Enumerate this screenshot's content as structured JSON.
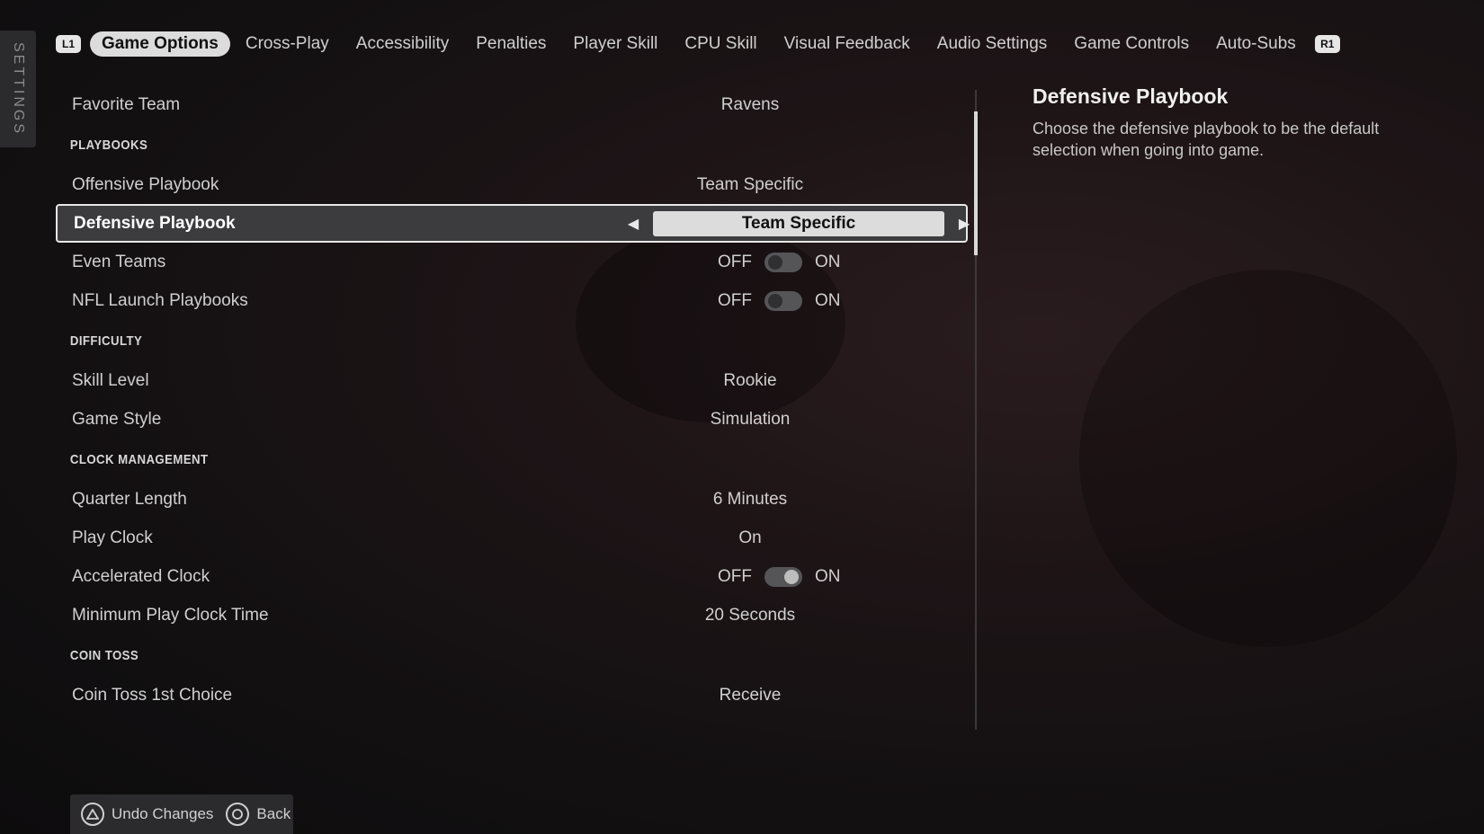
{
  "side_tab": {
    "label": "SETTINGS"
  },
  "nav": {
    "left_badge": "L1",
    "right_badge": "R1",
    "tabs": [
      "Game Options",
      "Cross-Play",
      "Accessibility",
      "Penalties",
      "Player Skill",
      "CPU Skill",
      "Visual Feedback",
      "Audio Settings",
      "Game Controls",
      "Auto-Subs"
    ],
    "active_tab": "Game Options"
  },
  "settings": {
    "favorite_team": {
      "label": "Favorite Team",
      "value": "Ravens"
    },
    "playbooks_header": "PLAYBOOKS",
    "offensive_playbook": {
      "label": "Offensive Playbook",
      "value": "Team Specific"
    },
    "defensive_playbook": {
      "label": "Defensive Playbook",
      "value": "Team Specific"
    },
    "even_teams": {
      "label": "Even Teams",
      "off": "OFF",
      "on": "ON",
      "state": "off"
    },
    "nfl_launch_playbooks": {
      "label": "NFL Launch Playbooks",
      "off": "OFF",
      "on": "ON",
      "state": "off"
    },
    "difficulty_header": "DIFFICULTY",
    "skill_level": {
      "label": "Skill Level",
      "value": "Rookie"
    },
    "game_style": {
      "label": "Game Style",
      "value": "Simulation"
    },
    "clock_header": "CLOCK MANAGEMENT",
    "quarter_length": {
      "label": "Quarter Length",
      "value": "6 Minutes"
    },
    "play_clock": {
      "label": "Play Clock",
      "value": "On"
    },
    "accelerated_clock": {
      "label": "Accelerated Clock",
      "off": "OFF",
      "on": "ON",
      "state": "on"
    },
    "min_play_clock": {
      "label": "Minimum Play Clock Time",
      "value": "20 Seconds"
    },
    "coin_toss_header": "COIN TOSS",
    "coin_toss_choice": {
      "label": "Coin Toss 1st Choice",
      "value": "Receive"
    }
  },
  "help": {
    "title": "Defensive Playbook",
    "description": "Choose the defensive playbook to be the default selection when going into game."
  },
  "footer": {
    "undo_label": "Undo Changes",
    "back_label": "Back"
  },
  "colors": {
    "selected_pill": "#dcdcdc",
    "background": "#121011"
  }
}
